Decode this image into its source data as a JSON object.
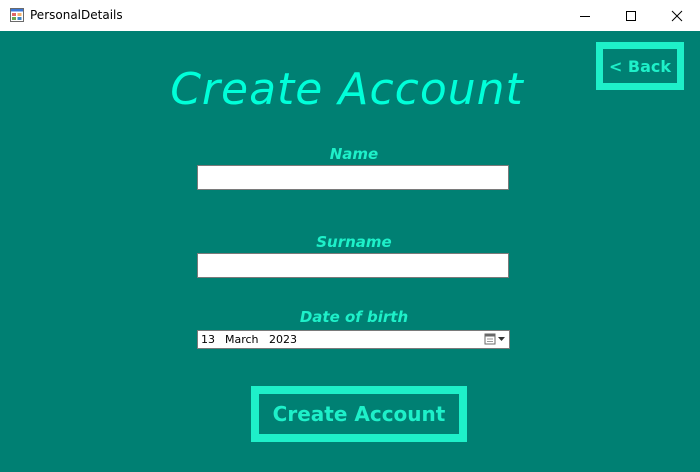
{
  "window": {
    "title": "PersonalDetails",
    "app_icon": "windows-form-icon",
    "controls": {
      "minimize_icon": "minimize-icon",
      "maximize_icon": "maximize-icon",
      "close_icon": "close-icon"
    }
  },
  "colors": {
    "background": "#008073",
    "accent": "#1ef0c9",
    "heading": "#00ffd9"
  },
  "form": {
    "heading": "Create Account",
    "back_label": "< Back",
    "name_label": "Name",
    "name_value": "",
    "surname_label": "Surname",
    "surname_value": "",
    "dob_label": "Date of birth",
    "dob": {
      "day": "13",
      "month": "March",
      "year": "2023",
      "dropdown_icon": "calendar-dropdown-icon"
    },
    "submit_label": "Create Account"
  }
}
